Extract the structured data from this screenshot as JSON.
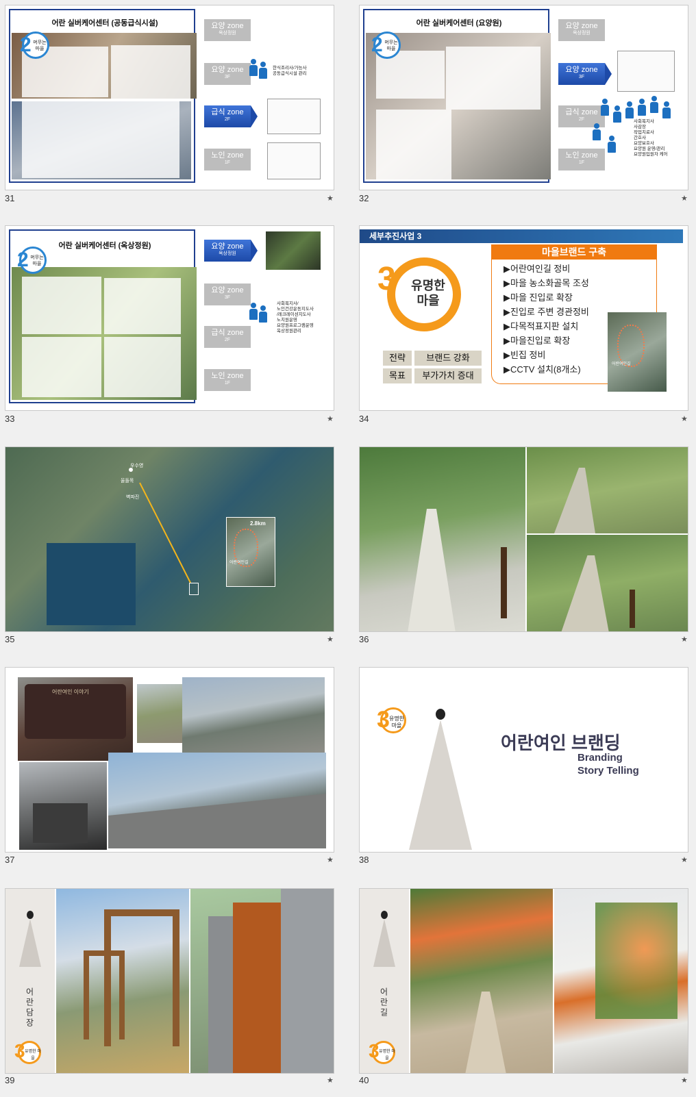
{
  "slides": [
    {
      "number": "31",
      "title": "어란 실버케어센터 (공동급식시설)",
      "badge_number": "2",
      "badge_text": "머무는 마을",
      "zones": [
        {
          "label": "요양 zone",
          "sub": "옥상정원"
        },
        {
          "label": "요양 zone",
          "sub": "3F"
        },
        {
          "label": "급식 zone",
          "sub": "2F",
          "active": true
        },
        {
          "label": "노인 zone",
          "sub": "1F"
        }
      ],
      "notes": [
        "한식조리사/가능사",
        "공동급식시설 관리"
      ]
    },
    {
      "number": "32",
      "title": "어란 실버케어센터 (요양원)",
      "badge_number": "2",
      "badge_text": "머무는 마을",
      "zones": [
        {
          "label": "요양 zone",
          "sub": "옥상정원"
        },
        {
          "label": "요양 zone",
          "sub": "3F",
          "active": true
        },
        {
          "label": "급식 zone",
          "sub": "2F"
        },
        {
          "label": "노인 zone",
          "sub": "1F"
        }
      ],
      "notes": [
        "사회복지사",
        "사감장",
        "작업치료사",
        "간호사",
        "요양보호사",
        "요양원 운영/관리",
        "요양원입원자 케어"
      ]
    },
    {
      "number": "33",
      "title": "어란 실버케어센터 (옥상정원)",
      "badge_number": "2",
      "badge_text": "머무는 마을",
      "zones": [
        {
          "label": "요양 zone",
          "sub": "옥상정원",
          "active": true
        },
        {
          "label": "요양 zone",
          "sub": "3F"
        },
        {
          "label": "급식 zone",
          "sub": "2F"
        },
        {
          "label": "노인 zone",
          "sub": "1F"
        }
      ],
      "notes": [
        "사회복지사/",
        "노인건강운동지도사",
        "/레크레이션지도사",
        "노치원운영",
        "요양원프로그램운영",
        "옥상정원관리"
      ]
    },
    {
      "number": "34",
      "header": "세부추진사업 3",
      "ring_number": "3",
      "ring_text1": "유명한",
      "ring_text2": "마을",
      "brand_title": "마을브랜드 구축",
      "items": [
        "▶어란여인길 정비",
        "▶마을 농소화골목 조성",
        "▶마을 진입로 확장",
        "▶진입로 주변 경관정비",
        "▶다목적표지판 설치",
        "▶마을진입로 확장",
        "▶빈집 정비",
        "▶CCTV 설치(8개소)"
      ],
      "tags": [
        [
          "전략",
          "브랜드 강화"
        ],
        [
          "목표",
          "부가가치 증대"
        ]
      ],
      "map_label": "어란여인길"
    },
    {
      "number": "35",
      "places": [
        "우수영",
        "울돌목",
        "벽파진",
        "어란여인길"
      ],
      "distance": "2.8km"
    },
    {
      "number": "36"
    },
    {
      "number": "37",
      "sign_title": "어란여인 이야기"
    },
    {
      "number": "38",
      "badge_number": "3",
      "badge_text": "유명한 마을",
      "title": "어란여인 브랜딩",
      "sub1": "Branding",
      "sub2": "Story Telling"
    },
    {
      "number": "39",
      "vertical": "어란담장",
      "badge_number": "3",
      "badge_text": "유명한 마을"
    },
    {
      "number": "40",
      "vertical": "어란길",
      "badge_number": "3",
      "badge_text": "유명한 마을"
    }
  ],
  "star": "★"
}
